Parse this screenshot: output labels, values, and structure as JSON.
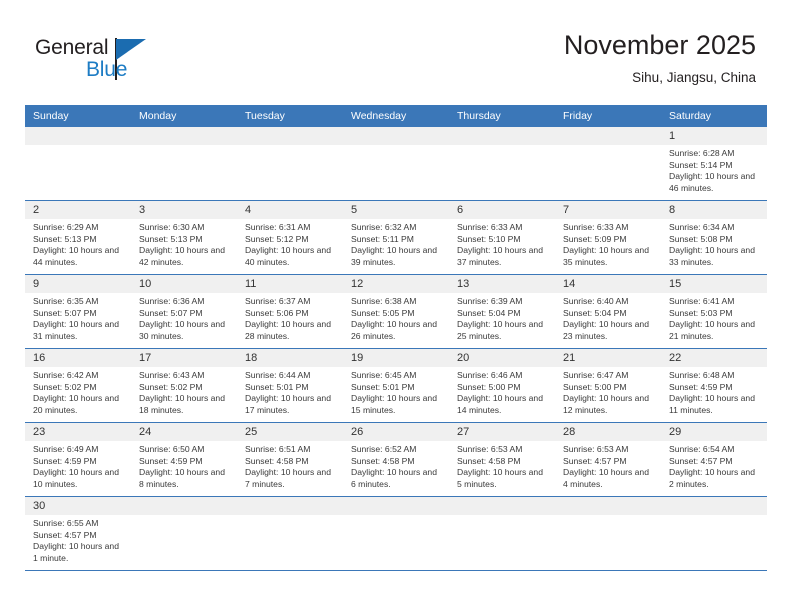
{
  "brand": {
    "name_part1": "General",
    "name_part2": "Blue",
    "logo_icon": "triangle-logo-icon"
  },
  "header": {
    "title": "November 2025",
    "location": "Sihu, Jiangsu, China"
  },
  "colors": {
    "header_row": "#3b77b8",
    "daynum_bg": "#f0f0f0",
    "brand_blue": "#1d7cc4",
    "text": "#231f20"
  },
  "calendar": {
    "weekday_headers": [
      "Sunday",
      "Monday",
      "Tuesday",
      "Wednesday",
      "Thursday",
      "Friday",
      "Saturday"
    ],
    "labels": {
      "sunrise": "Sunrise:",
      "sunset": "Sunset:",
      "daylight": "Daylight:"
    },
    "weeks": [
      [
        {
          "empty": true
        },
        {
          "empty": true
        },
        {
          "empty": true
        },
        {
          "empty": true
        },
        {
          "empty": true
        },
        {
          "empty": true
        },
        {
          "day": "1",
          "sunrise": "Sunrise: 6:28 AM",
          "sunset": "Sunset: 5:14 PM",
          "daylight": "Daylight: 10 hours and 46 minutes."
        }
      ],
      [
        {
          "day": "2",
          "sunrise": "Sunrise: 6:29 AM",
          "sunset": "Sunset: 5:13 PM",
          "daylight": "Daylight: 10 hours and 44 minutes."
        },
        {
          "day": "3",
          "sunrise": "Sunrise: 6:30 AM",
          "sunset": "Sunset: 5:13 PM",
          "daylight": "Daylight: 10 hours and 42 minutes."
        },
        {
          "day": "4",
          "sunrise": "Sunrise: 6:31 AM",
          "sunset": "Sunset: 5:12 PM",
          "daylight": "Daylight: 10 hours and 40 minutes."
        },
        {
          "day": "5",
          "sunrise": "Sunrise: 6:32 AM",
          "sunset": "Sunset: 5:11 PM",
          "daylight": "Daylight: 10 hours and 39 minutes."
        },
        {
          "day": "6",
          "sunrise": "Sunrise: 6:33 AM",
          "sunset": "Sunset: 5:10 PM",
          "daylight": "Daylight: 10 hours and 37 minutes."
        },
        {
          "day": "7",
          "sunrise": "Sunrise: 6:33 AM",
          "sunset": "Sunset: 5:09 PM",
          "daylight": "Daylight: 10 hours and 35 minutes."
        },
        {
          "day": "8",
          "sunrise": "Sunrise: 6:34 AM",
          "sunset": "Sunset: 5:08 PM",
          "daylight": "Daylight: 10 hours and 33 minutes."
        }
      ],
      [
        {
          "day": "9",
          "sunrise": "Sunrise: 6:35 AM",
          "sunset": "Sunset: 5:07 PM",
          "daylight": "Daylight: 10 hours and 31 minutes."
        },
        {
          "day": "10",
          "sunrise": "Sunrise: 6:36 AM",
          "sunset": "Sunset: 5:07 PM",
          "daylight": "Daylight: 10 hours and 30 minutes."
        },
        {
          "day": "11",
          "sunrise": "Sunrise: 6:37 AM",
          "sunset": "Sunset: 5:06 PM",
          "daylight": "Daylight: 10 hours and 28 minutes."
        },
        {
          "day": "12",
          "sunrise": "Sunrise: 6:38 AM",
          "sunset": "Sunset: 5:05 PM",
          "daylight": "Daylight: 10 hours and 26 minutes."
        },
        {
          "day": "13",
          "sunrise": "Sunrise: 6:39 AM",
          "sunset": "Sunset: 5:04 PM",
          "daylight": "Daylight: 10 hours and 25 minutes."
        },
        {
          "day": "14",
          "sunrise": "Sunrise: 6:40 AM",
          "sunset": "Sunset: 5:04 PM",
          "daylight": "Daylight: 10 hours and 23 minutes."
        },
        {
          "day": "15",
          "sunrise": "Sunrise: 6:41 AM",
          "sunset": "Sunset: 5:03 PM",
          "daylight": "Daylight: 10 hours and 21 minutes."
        }
      ],
      [
        {
          "day": "16",
          "sunrise": "Sunrise: 6:42 AM",
          "sunset": "Sunset: 5:02 PM",
          "daylight": "Daylight: 10 hours and 20 minutes."
        },
        {
          "day": "17",
          "sunrise": "Sunrise: 6:43 AM",
          "sunset": "Sunset: 5:02 PM",
          "daylight": "Daylight: 10 hours and 18 minutes."
        },
        {
          "day": "18",
          "sunrise": "Sunrise: 6:44 AM",
          "sunset": "Sunset: 5:01 PM",
          "daylight": "Daylight: 10 hours and 17 minutes."
        },
        {
          "day": "19",
          "sunrise": "Sunrise: 6:45 AM",
          "sunset": "Sunset: 5:01 PM",
          "daylight": "Daylight: 10 hours and 15 minutes."
        },
        {
          "day": "20",
          "sunrise": "Sunrise: 6:46 AM",
          "sunset": "Sunset: 5:00 PM",
          "daylight": "Daylight: 10 hours and 14 minutes."
        },
        {
          "day": "21",
          "sunrise": "Sunrise: 6:47 AM",
          "sunset": "Sunset: 5:00 PM",
          "daylight": "Daylight: 10 hours and 12 minutes."
        },
        {
          "day": "22",
          "sunrise": "Sunrise: 6:48 AM",
          "sunset": "Sunset: 4:59 PM",
          "daylight": "Daylight: 10 hours and 11 minutes."
        }
      ],
      [
        {
          "day": "23",
          "sunrise": "Sunrise: 6:49 AM",
          "sunset": "Sunset: 4:59 PM",
          "daylight": "Daylight: 10 hours and 10 minutes."
        },
        {
          "day": "24",
          "sunrise": "Sunrise: 6:50 AM",
          "sunset": "Sunset: 4:59 PM",
          "daylight": "Daylight: 10 hours and 8 minutes."
        },
        {
          "day": "25",
          "sunrise": "Sunrise: 6:51 AM",
          "sunset": "Sunset: 4:58 PM",
          "daylight": "Daylight: 10 hours and 7 minutes."
        },
        {
          "day": "26",
          "sunrise": "Sunrise: 6:52 AM",
          "sunset": "Sunset: 4:58 PM",
          "daylight": "Daylight: 10 hours and 6 minutes."
        },
        {
          "day": "27",
          "sunrise": "Sunrise: 6:53 AM",
          "sunset": "Sunset: 4:58 PM",
          "daylight": "Daylight: 10 hours and 5 minutes."
        },
        {
          "day": "28",
          "sunrise": "Sunrise: 6:53 AM",
          "sunset": "Sunset: 4:57 PM",
          "daylight": "Daylight: 10 hours and 4 minutes."
        },
        {
          "day": "29",
          "sunrise": "Sunrise: 6:54 AM",
          "sunset": "Sunset: 4:57 PM",
          "daylight": "Daylight: 10 hours and 2 minutes."
        }
      ],
      [
        {
          "day": "30",
          "sunrise": "Sunrise: 6:55 AM",
          "sunset": "Sunset: 4:57 PM",
          "daylight": "Daylight: 10 hours and 1 minute."
        },
        {
          "empty": true
        },
        {
          "empty": true
        },
        {
          "empty": true
        },
        {
          "empty": true
        },
        {
          "empty": true
        },
        {
          "empty": true
        }
      ]
    ]
  }
}
